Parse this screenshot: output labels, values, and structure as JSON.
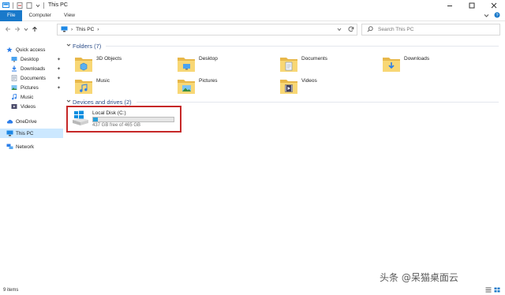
{
  "window": {
    "title": "This PC"
  },
  "ribbon": {
    "tabs": [
      "File",
      "Computer",
      "View"
    ]
  },
  "address": {
    "location": "This PC"
  },
  "search": {
    "placeholder": "Search This PC"
  },
  "sidebar": {
    "items": [
      {
        "label": "Quick access",
        "icon": "star-icon"
      },
      {
        "label": "Desktop",
        "icon": "desktop-icon",
        "pinned": true
      },
      {
        "label": "Downloads",
        "icon": "downloads-icon",
        "pinned": true
      },
      {
        "label": "Documents",
        "icon": "documents-icon",
        "pinned": true
      },
      {
        "label": "Pictures",
        "icon": "pictures-icon",
        "pinned": true
      },
      {
        "label": "Music",
        "icon": "music-icon"
      },
      {
        "label": "Videos",
        "icon": "videos-icon"
      },
      {
        "label": "OneDrive",
        "icon": "cloud-icon"
      },
      {
        "label": "This PC",
        "icon": "computer-icon",
        "selected": true
      },
      {
        "label": "Network",
        "icon": "network-icon"
      }
    ]
  },
  "folders": {
    "heading": "Folders (7)",
    "items": [
      {
        "label": "3D Objects",
        "icon": "3d-objects-folder-icon"
      },
      {
        "label": "Desktop",
        "icon": "desktop-folder-icon"
      },
      {
        "label": "Documents",
        "icon": "documents-folder-icon"
      },
      {
        "label": "Downloads",
        "icon": "downloads-folder-icon"
      },
      {
        "label": "Music",
        "icon": "music-folder-icon"
      },
      {
        "label": "Pictures",
        "icon": "pictures-folder-icon"
      },
      {
        "label": "Videos",
        "icon": "videos-folder-icon"
      }
    ]
  },
  "devices": {
    "heading": "Devices and drives (2)",
    "drive": {
      "name": "Local Disk (C:)",
      "free_text": "437 GB free of 465 GB",
      "used_fraction": 0.06
    }
  },
  "status": {
    "items_count": "9 items"
  },
  "watermark": "头条 @呆猫桌面云",
  "colors": {
    "accent": "#1979ca",
    "selection": "#cce8ff",
    "highlight_box": "#c62828",
    "drive_fill": "#26a0da",
    "folder_yellow": "#f8d775"
  }
}
